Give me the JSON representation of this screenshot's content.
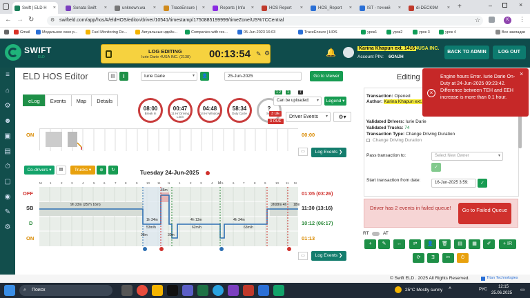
{
  "browser": {
    "tabs": [
      {
        "label": "Swift | ELD H",
        "color": "#1a7f5a",
        "active": true
      },
      {
        "label": "Sonata Swift",
        "color": "#7b3fbf"
      },
      {
        "label": "unknown.wa",
        "color": "#777"
      },
      {
        "label": "TraceEnsure |",
        "color": "#d08a1c"
      },
      {
        "label": "Reports | Infu",
        "color": "#8a2be2"
      },
      {
        "label": "HOS Report",
        "color": "#c0392b"
      },
      {
        "label": "HOS_Report",
        "color": "#2a6fd6"
      },
      {
        "label": "IST - точний",
        "color": "#2a6fd6"
      },
      {
        "label": "di-DECK9M",
        "color": "#c0392b"
      }
    ],
    "url": "swifteld.com/app/hos/#/eldHOS/editor/driver/10541/timestamp/1750885199999/timeZone/US%7CCentral",
    "bookmarks": [
      "Gmail",
      "Модальное окно р...",
      "Fuel Monitoring De...",
      "Актуальные идейн...",
      "Companies with res...",
      "05-Jun-2023 16:03",
      "TraceEnsure | HOS",
      "урок1",
      "урок2",
      "урок 3",
      "урок 4",
      "Все закладки"
    ]
  },
  "header": {
    "logo_text": "SWIFT",
    "logo_sub": "ELD",
    "log_editing_label": "LOG EDITING",
    "log_editing_sub": "Iurie Darie   4USA INC. (2138)",
    "timer": "00:13:54",
    "user_name": "Karina Khapun ext. 1416",
    "company": "4USA INC.",
    "account_pin_label": "Account PIN:",
    "account_pin": "6GNJH",
    "back_to_admin": "BACK TO ADMIN",
    "logout": "LOG OUT"
  },
  "editor": {
    "title": "ELD HOS Editor",
    "driver_select": "Iurie Darie",
    "date": "25-Jun-2025",
    "go_to_viewer": "Go to Viewer",
    "tabs": [
      "eLog",
      "Events",
      "Map",
      "Details"
    ],
    "circles": [
      {
        "value": "08:00",
        "label": "Break In"
      },
      {
        "value": "00:47",
        "label": "11 Hr Driving Limit"
      },
      {
        "value": "04:48",
        "label": "14 Hr Window"
      },
      {
        "value": "58:34",
        "label": "Duty Cycle"
      },
      {
        "value": "?",
        "label": "Sep"
      }
    ],
    "can_be_uploaded": "Can be uploaded:",
    "legend": "Legend",
    "driver_events": "Driver Events",
    "ue_badges": [
      "3 UE",
      "3 OUE"
    ],
    "small_badges": [
      "1 2",
      "1",
      "7"
    ],
    "on_label": "ON",
    "top_total": "00:00",
    "log_events": "Log Events",
    "co_drivers": "Co-drivers",
    "trucks": "Trucks",
    "day_title": "Tuesday 24-Jun-2025",
    "statuses": [
      {
        "code": "OFF",
        "color": "#d0312d",
        "total": "01:05 (03:26)"
      },
      {
        "code": "SB",
        "color": "#222222",
        "total": "11:30 (13:16)"
      },
      {
        "code": "D",
        "color": "#2e8b3c",
        "total": "10:12 (06:17)"
      },
      {
        "code": "ON",
        "color": "#d98a00",
        "total": "01:13"
      }
    ],
    "hour_ticks": [
      "M",
      "1",
      "2",
      "3",
      "4",
      "5",
      "6",
      "7",
      "8",
      "9",
      "10",
      "11",
      "N",
      "1",
      "2",
      "3",
      "4",
      "5",
      "6",
      "7",
      "8",
      "9",
      "10",
      "11",
      "M"
    ],
    "segment_labels": [
      "9h 23m (257h 16m)",
      "46m",
      "1h 34m",
      "4h 13m",
      "4h 34m",
      "2h08m 4h",
      "18m",
      "53m/h",
      "62m/h",
      "63m/h",
      "30m",
      "28m",
      "M"
    ]
  },
  "right_panel": {
    "title": "Editing",
    "transaction_label": "Transaction:",
    "transaction_value": "Opened",
    "author_label": "Author:",
    "author_value": "Karina Khapun ext.",
    "validated_drivers_label": "Validated Drivers:",
    "validated_drivers_value": "Iurie Darie",
    "validated_trucks_label": "Validated Trucks:",
    "validated_trucks_value": "74",
    "transaction_type_label": "Transaction Type:",
    "transaction_type_value": "Change Driving Duration",
    "checkbox_label": "Change Driving Duration",
    "pass_to_label": "Pass transaction to:",
    "pass_to_placeholder": "Select New Owner",
    "start_from_label": "Start transaction from date:",
    "start_from_value": "16-Jun-2025 3:59:",
    "failed_text": "Driver has 2 events in failed queue!",
    "go_to_failed": "Go to Failed Queue",
    "rt_label": "RT",
    "at_label": "AT"
  },
  "error_toast": {
    "text": "Engine hours Error. Iurie Darie On-Duty at 24-Jun-2025 09:23:42. Difference between TEH and EEH increase is more than 0.1 hour."
  },
  "footer": {
    "copyright": "© Swift ELD . 2025 All Rights Reserved.",
    "brand": "Titan Technologies"
  },
  "taskbar": {
    "search": "Поиск",
    "weather": "25°C  Mostly sunny",
    "lang": "РУС",
    "time": "12:15",
    "date": "25.06.2025"
  }
}
